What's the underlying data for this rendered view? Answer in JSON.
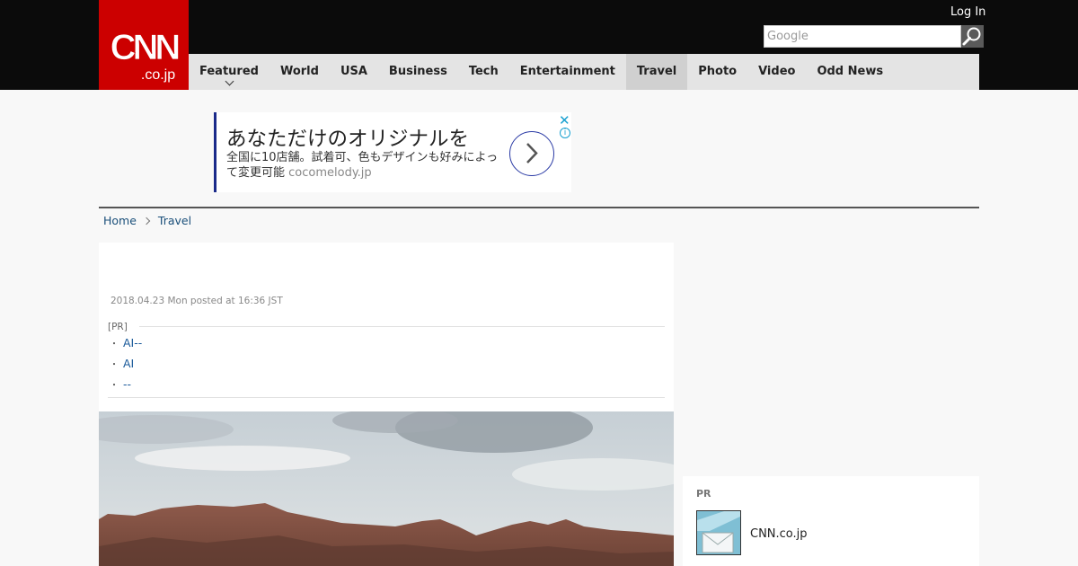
{
  "header": {
    "logo_text": "CNN",
    "logo_subtext": ".co.jp",
    "login_label": "Log In",
    "search_placeholder": "Google"
  },
  "nav": {
    "items": [
      {
        "label": "Featured"
      },
      {
        "label": "World"
      },
      {
        "label": "USA"
      },
      {
        "label": "Business"
      },
      {
        "label": "Tech"
      },
      {
        "label": "Entertainment"
      },
      {
        "label": "Travel",
        "active": true
      },
      {
        "label": "Photo"
      },
      {
        "label": "Video"
      },
      {
        "label": "Odd News"
      }
    ]
  },
  "ad": {
    "title": "あなただけのオリジナルを",
    "description": "全国に10店舗。試着可、色もデザインも好みによって変更可能",
    "domain": "cocomelody.jp",
    "close_symbol": "✕",
    "info_symbol": "i"
  },
  "breadcrumb": {
    "home": "Home",
    "current": "Travel"
  },
  "article": {
    "date": "2018.04.23 Mon posted at 16:36 JST",
    "pr_label": "[PR]",
    "pr_links": [
      "AI--",
      "AI",
      "--"
    ],
    "bullet": "・"
  },
  "sidebar": {
    "pr_label": "PR",
    "link_label": "CNN.co.jp"
  },
  "colors": {
    "brand_red": "#cc0000",
    "header_bg": "#0b0b0b",
    "nav_bg": "#e4e4e4",
    "link_blue": "#1a5a9a"
  }
}
